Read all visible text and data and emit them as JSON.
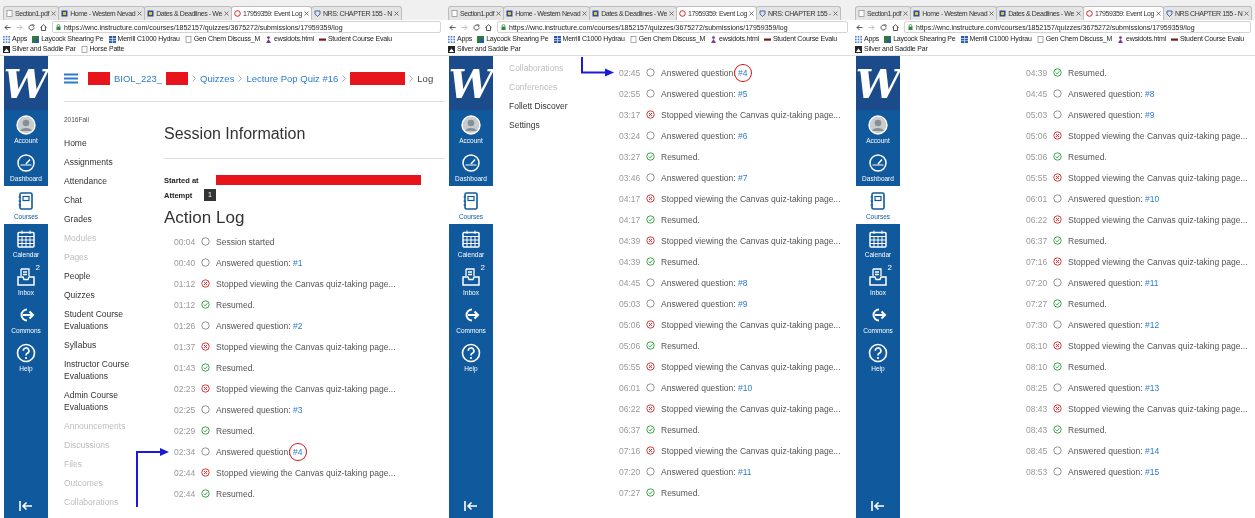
{
  "panels": [
    {
      "browser": {
        "tabs": [
          {
            "title": "Section1.pdf",
            "selected": false
          },
          {
            "title": "Home - Western Nevad",
            "selected": false
          },
          {
            "title": "Dates & Deadlines - We",
            "selected": false
          },
          {
            "title": "17959359: Event Log",
            "selected": true
          },
          {
            "title": "NRS: CHAPTER 155 - N",
            "selected": false
          }
        ],
        "url": "https://wnc.instructure.com/courses/1852157/quizzes/3675272/submissions/17959359/log",
        "bookmarks": [
          "Apps",
          "Laycock Shearing Pe",
          "Merrill C1000 Hydrau",
          "Gen Chem Discuss_M",
          "ewsidots.html",
          "Student Course Evalu",
          "Silver and Saddle Par",
          "Horse Patte"
        ]
      },
      "global_nav": {
        "logo": "W",
        "items": [
          {
            "label": "Account",
            "selected": false
          },
          {
            "label": "Dashboard",
            "selected": false
          },
          {
            "label": "Courses",
            "selected": true
          },
          {
            "label": "Calendar",
            "selected": false
          },
          {
            "label": "Inbox",
            "selected": false,
            "badge": "2"
          },
          {
            "label": "Commons",
            "selected": false
          },
          {
            "label": "Help",
            "selected": false
          }
        ]
      },
      "breadcrumb": [
        {
          "kind": "redacted"
        },
        {
          "kind": "link",
          "text": "BIOL_223_"
        },
        {
          "kind": "redacted"
        },
        {
          "kind": "separator"
        },
        {
          "kind": "link",
          "text": "Quizzes"
        },
        {
          "kind": "separator"
        },
        {
          "kind": "link",
          "text": "Lecture Pop Quiz #16"
        },
        {
          "kind": "separator"
        },
        {
          "kind": "redacted_wide"
        },
        {
          "kind": "separator"
        },
        {
          "kind": "current",
          "text": "Log"
        }
      ],
      "course_nav": {
        "term": "2016Fall",
        "items": [
          {
            "label": "Home",
            "disabled": false
          },
          {
            "label": "Assignments",
            "disabled": false
          },
          {
            "label": "Attendance",
            "disabled": false
          },
          {
            "label": "Chat",
            "disabled": false
          },
          {
            "label": "Grades",
            "disabled": false
          },
          {
            "label": "Modules",
            "disabled": true
          },
          {
            "label": "Pages",
            "disabled": true
          },
          {
            "label": "People",
            "disabled": false
          },
          {
            "label": "Quizzes",
            "disabled": false
          },
          {
            "label": "Student Course Evaluations",
            "disabled": false
          },
          {
            "label": "Syllabus",
            "disabled": false
          },
          {
            "label": "Instructor Course Evaluations",
            "disabled": false
          },
          {
            "label": "Admin Course Evaluations",
            "disabled": false
          },
          {
            "label": "Announcements",
            "disabled": true
          },
          {
            "label": "Discussions",
            "disabled": true
          },
          {
            "label": "Files",
            "disabled": true
          },
          {
            "label": "Outcomes",
            "disabled": true
          },
          {
            "label": "Collaborations",
            "disabled": true
          }
        ]
      },
      "session_info": {
        "title": "Session Information",
        "started_label": "Started at",
        "attempt_label": "Attempt",
        "attempt": "1"
      },
      "action_log": {
        "title": "Action Log",
        "entries": [
          {
            "time": "00:04",
            "kind": "plain",
            "text": "Session started",
            "circled": false
          },
          {
            "time": "00:40",
            "kind": "plain",
            "text": "Answered question:",
            "link": "#1",
            "circled": false
          },
          {
            "time": "01:12",
            "kind": "stopped",
            "text": "Stopped viewing the Canvas quiz-taking page...",
            "circled": false
          },
          {
            "time": "01:12",
            "kind": "resumed",
            "text": "Resumed.",
            "circled": false
          },
          {
            "time": "01:26",
            "kind": "plain",
            "text": "Answered question:",
            "link": "#2",
            "circled": false
          },
          {
            "time": "01:37",
            "kind": "stopped",
            "text": "Stopped viewing the Canvas quiz-taking page...",
            "circled": false
          },
          {
            "time": "01:43",
            "kind": "resumed",
            "text": "Resumed.",
            "circled": false
          },
          {
            "time": "02:23",
            "kind": "stopped",
            "text": "Stopped viewing the Canvas quiz-taking page...",
            "circled": false
          },
          {
            "time": "02:25",
            "kind": "plain",
            "text": "Answered question:",
            "link": "#3",
            "circled": false
          },
          {
            "time": "02:29",
            "kind": "resumed",
            "text": "Resumed.",
            "circled": false
          },
          {
            "time": "02:34",
            "kind": "plain",
            "text": "Answered question:",
            "link": "#4",
            "circled": true
          },
          {
            "time": "02:44",
            "kind": "stopped",
            "text": "Stopped viewing the Canvas quiz-taking page...",
            "circled": false
          },
          {
            "time": "02:44",
            "kind": "resumed",
            "text": "Resumed.",
            "circled": false
          }
        ]
      }
    },
    {
      "browser": {
        "tabs": [
          {
            "title": "Section1.pdf",
            "selected": false
          },
          {
            "title": "Home - Western Nevad",
            "selected": false
          },
          {
            "title": "Dates & Deadlines - We",
            "selected": false
          },
          {
            "title": "17959359: Event Log",
            "selected": true
          },
          {
            "title": "NRS: CHAPTER 155 -",
            "selected": false
          }
        ],
        "url": "https://wnc.instructure.com/courses/1852157/quizzes/3675272/submissions/17959359/log",
        "bookmarks": [
          "Apps",
          "Laycock Shearing Pe",
          "Merrill C1000 Hydrau",
          "Gen Chem Discuss_M",
          "ewsidots.html",
          "Student Course Evalu",
          "Silver and Saddle Par"
        ]
      },
      "global_nav": {
        "logo": "W",
        "items": [
          {
            "label": "Account",
            "selected": false
          },
          {
            "label": "Dashboard",
            "selected": false
          },
          {
            "label": "Courses",
            "selected": true
          },
          {
            "label": "Calendar",
            "selected": false
          },
          {
            "label": "Inbox",
            "selected": false,
            "badge": "2"
          },
          {
            "label": "Commons",
            "selected": false
          },
          {
            "label": "Help",
            "selected": false
          }
        ]
      },
      "course_nav": {
        "items": [
          {
            "label": "Collaborations",
            "disabled": true
          },
          {
            "label": "Conferences",
            "disabled": true
          },
          {
            "label": "Follett Discover",
            "disabled": false
          },
          {
            "label": "Settings",
            "disabled": false
          }
        ]
      },
      "action_log": {
        "entries": [
          {
            "time": "02:45",
            "kind": "plain",
            "text": "Answered question:",
            "link": "#4",
            "circled": true
          },
          {
            "time": "02:55",
            "kind": "plain",
            "text": "Answered question:",
            "link": "#5",
            "circled": false
          },
          {
            "time": "03:17",
            "kind": "stopped",
            "text": "Stopped viewing the Canvas quiz-taking page...",
            "circled": false
          },
          {
            "time": "03:24",
            "kind": "plain",
            "text": "Answered question:",
            "link": "#6",
            "circled": false
          },
          {
            "time": "03:27",
            "kind": "resumed",
            "text": "Resumed.",
            "circled": false
          },
          {
            "time": "03:46",
            "kind": "plain",
            "text": "Answered question:",
            "link": "#7",
            "circled": false
          },
          {
            "time": "04:17",
            "kind": "stopped",
            "text": "Stopped viewing the Canvas quiz-taking page...",
            "circled": false
          },
          {
            "time": "04:17",
            "kind": "resumed",
            "text": "Resumed.",
            "circled": false
          },
          {
            "time": "04:39",
            "kind": "stopped",
            "text": "Stopped viewing the Canvas quiz-taking page...",
            "circled": false
          },
          {
            "time": "04:39",
            "kind": "resumed",
            "text": "Resumed.",
            "circled": false
          },
          {
            "time": "04:45",
            "kind": "plain",
            "text": "Answered question:",
            "link": "#8",
            "circled": false
          },
          {
            "time": "05:03",
            "kind": "plain",
            "text": "Answered question:",
            "link": "#9",
            "circled": false
          },
          {
            "time": "05:06",
            "kind": "stopped",
            "text": "Stopped viewing the Canvas quiz-taking page...",
            "circled": false
          },
          {
            "time": "05:06",
            "kind": "resumed",
            "text": "Resumed.",
            "circled": false
          },
          {
            "time": "05:55",
            "kind": "stopped",
            "text": "Stopped viewing the Canvas quiz-taking page...",
            "circled": false
          },
          {
            "time": "06:01",
            "kind": "plain",
            "text": "Answered question:",
            "link": "#10",
            "circled": false
          },
          {
            "time": "06:22",
            "kind": "stopped",
            "text": "Stopped viewing the Canvas quiz-taking page...",
            "circled": false
          },
          {
            "time": "06:37",
            "kind": "resumed",
            "text": "Resumed.",
            "circled": false
          },
          {
            "time": "07:16",
            "kind": "stopped",
            "text": "Stopped viewing the Canvas quiz-taking page...",
            "circled": false
          },
          {
            "time": "07:20",
            "kind": "plain",
            "text": "Answered question:",
            "link": "#11",
            "circled": false
          },
          {
            "time": "07:27",
            "kind": "resumed",
            "text": "Resumed.",
            "circled": false
          }
        ]
      }
    },
    {
      "browser": {
        "tabs": [
          {
            "title": "Section1.pdf",
            "selected": false
          },
          {
            "title": "Home - Western Nevad",
            "selected": false
          },
          {
            "title": "Dates & Deadlines - We",
            "selected": false
          },
          {
            "title": "17959359: Event Log",
            "selected": true
          },
          {
            "title": "NRS CHAPTER 155 - N",
            "selected": false
          }
        ],
        "url": "https://wnc.instructure.com/courses/1852157/quizzes/3675272/submissions/17959359/log",
        "bookmarks": [
          "Apps",
          "Laycock Shearing Pe",
          "Merrill C1000 Hydrau",
          "Gen Chem Discuss_M",
          "ewsidots.html",
          "Student Course Evalu",
          "Silver and Saddle Par"
        ]
      },
      "global_nav": {
        "logo": "W",
        "items": [
          {
            "label": "Account",
            "selected": false
          },
          {
            "label": "Dashboard",
            "selected": false
          },
          {
            "label": "Courses",
            "selected": true
          },
          {
            "label": "Calendar",
            "selected": false
          },
          {
            "label": "Inbox",
            "selected": false,
            "badge": "2"
          },
          {
            "label": "Commons",
            "selected": false
          },
          {
            "label": "Help",
            "selected": false
          }
        ]
      },
      "action_log": {
        "entries": [
          {
            "time": "04:39",
            "kind": "resumed",
            "text": "Resumed.",
            "circled": false
          },
          {
            "time": "04:45",
            "kind": "plain",
            "text": "Answered question:",
            "link": "#8",
            "circled": false
          },
          {
            "time": "05:03",
            "kind": "plain",
            "text": "Answered question:",
            "link": "#9",
            "circled": false
          },
          {
            "time": "05:06",
            "kind": "stopped",
            "text": "Stopped viewing the Canvas quiz-taking page...",
            "circled": false
          },
          {
            "time": "05:06",
            "kind": "resumed",
            "text": "Resumed.",
            "circled": false
          },
          {
            "time": "05:55",
            "kind": "stopped",
            "text": "Stopped viewing the Canvas quiz-taking page...",
            "circled": false
          },
          {
            "time": "06:01",
            "kind": "plain",
            "text": "Answered question:",
            "link": "#10",
            "circled": false
          },
          {
            "time": "06:22",
            "kind": "stopped",
            "text": "Stopped viewing the Canvas quiz-taking page...",
            "circled": false
          },
          {
            "time": "06:37",
            "kind": "resumed",
            "text": "Resumed.",
            "circled": false
          },
          {
            "time": "07:16",
            "kind": "stopped",
            "text": "Stopped viewing the Canvas quiz-taking page...",
            "circled": false
          },
          {
            "time": "07:20",
            "kind": "plain",
            "text": "Answered question:",
            "link": "#11",
            "circled": false
          },
          {
            "time": "07:27",
            "kind": "resumed",
            "text": "Resumed.",
            "circled": false
          },
          {
            "time": "07:30",
            "kind": "plain",
            "text": "Answered question:",
            "link": "#12",
            "circled": false
          },
          {
            "time": "08:10",
            "kind": "stopped",
            "text": "Stopped viewing the Canvas quiz-taking page...",
            "circled": false
          },
          {
            "time": "08:10",
            "kind": "resumed",
            "text": "Resumed.",
            "circled": false
          },
          {
            "time": "08:25",
            "kind": "plain",
            "text": "Answered question:",
            "link": "#13",
            "circled": false
          },
          {
            "time": "08:43",
            "kind": "stopped",
            "text": "Stopped viewing the Canvas quiz-taking page...",
            "circled": false
          },
          {
            "time": "08:43",
            "kind": "resumed",
            "text": "Resumed.",
            "circled": false
          },
          {
            "time": "08:45",
            "kind": "plain",
            "text": "Answered question:",
            "link": "#14",
            "circled": false
          },
          {
            "time": "08:53",
            "kind": "plain",
            "text": "Answered question:",
            "link": "#15",
            "circled": false
          }
        ]
      }
    }
  ]
}
